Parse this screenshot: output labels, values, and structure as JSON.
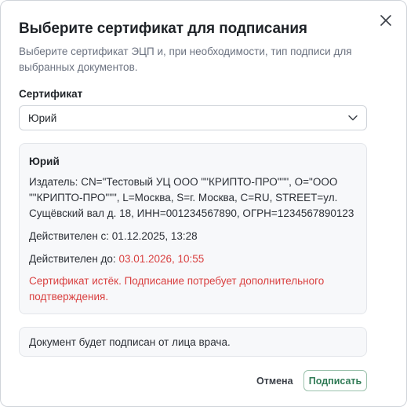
{
  "dialog": {
    "title": "Выберите сертификат для подписания",
    "description": "Выберите сертификат ЭЦП и, при необходимости, тип подписи для выбранных документов.",
    "close_icon": "close-icon"
  },
  "certificate_field": {
    "label": "Сертификат",
    "selected_value": "Юрий",
    "chevron_icon": "chevron-down-icon"
  },
  "certificate_details": {
    "name": "Юрий",
    "issuer": "Издатель: CN=\"Тестовый УЦ ООО \"\"КРИПТО-ПРО\"\"\", O=\"ООО \"\"КРИПТО-ПРО\"\"\", L=Москва, S=г. Москва, C=RU, STREET=ул. Сущёвский вал д. 18, ИНН=001234567890, ОГРН=1234567890123",
    "valid_from_label": "Действителен с:",
    "valid_from_value": "01.12.2025, 13:28",
    "valid_to_label": "Действителен до:",
    "valid_to_value": "03.01.2026, 10:55",
    "warning": "Сертификат истёк. Подписание потребует дополнительного подтверждения."
  },
  "signer_note": "Документ будет подписан от лица врача.",
  "actions": {
    "cancel_label": "Отмена",
    "sign_label": "Подписать"
  },
  "colors": {
    "error": "#d93f3f",
    "accent": "#2f7a55",
    "accent_border": "#9cc2ad",
    "card_background": "#f7f8fa"
  }
}
